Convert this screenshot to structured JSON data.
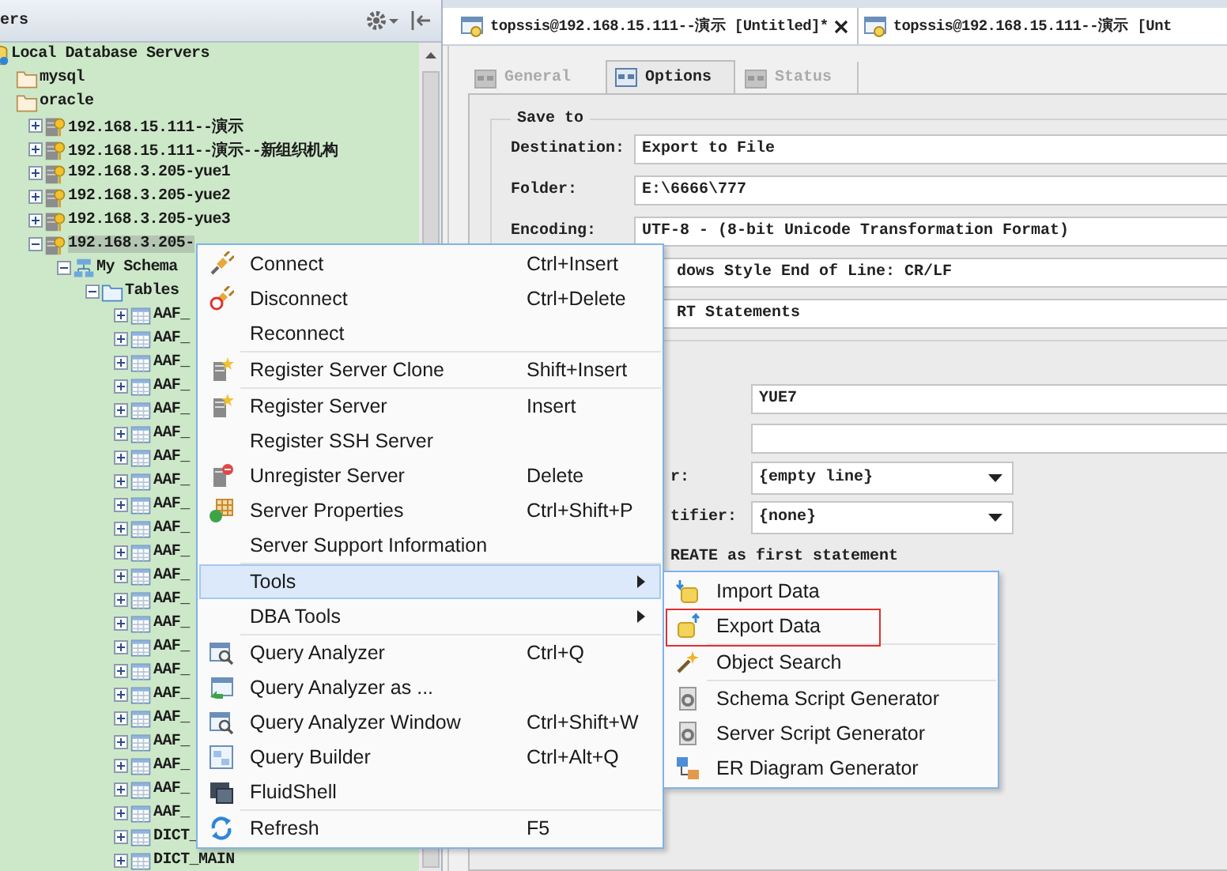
{
  "left_panel": {
    "title": "ers",
    "tree": [
      {
        "label": "Local Database Servers",
        "kind": "root",
        "selected": false,
        "children": [
          {
            "label": "mysql",
            "kind": "folder",
            "selected": false
          },
          {
            "label": "oracle",
            "kind": "folder",
            "selected": false,
            "children": [
              {
                "label": "192.168.15.111--演示",
                "kind": "server",
                "expanded": false,
                "selected": false
              },
              {
                "label": "192.168.15.111--演示--新组织机构",
                "kind": "server",
                "expanded": false,
                "selected": false
              },
              {
                "label": "192.168.3.205-yue1",
                "kind": "server",
                "expanded": false,
                "selected": false
              },
              {
                "label": "192.168.3.205-yue2",
                "kind": "server",
                "expanded": false,
                "selected": false
              },
              {
                "label": "192.168.3.205-yue3",
                "kind": "server",
                "expanded": false,
                "selected": false
              },
              {
                "label": "192.168.3.205-",
                "kind": "server",
                "expanded": true,
                "selected": true,
                "children": [
                  {
                    "label": "My Schema",
                    "kind": "schema",
                    "expanded": true,
                    "selected": false,
                    "children": [
                      {
                        "label": "Tables",
                        "kind": "tables",
                        "expanded": true,
                        "selected": false,
                        "children": [
                          {
                            "label": "AAF_",
                            "kind": "table",
                            "expanded": false,
                            "selected": false
                          },
                          {
                            "label": "AAF_",
                            "kind": "table",
                            "expanded": false,
                            "selected": false
                          },
                          {
                            "label": "AAF_",
                            "kind": "table",
                            "expanded": false,
                            "selected": false
                          },
                          {
                            "label": "AAF_",
                            "kind": "table",
                            "expanded": false,
                            "selected": false
                          },
                          {
                            "label": "AAF_",
                            "kind": "table",
                            "expanded": false,
                            "selected": false
                          },
                          {
                            "label": "AAF_",
                            "kind": "table",
                            "expanded": false,
                            "selected": false
                          },
                          {
                            "label": "AAF_",
                            "kind": "table",
                            "expanded": false,
                            "selected": false
                          },
                          {
                            "label": "AAF_",
                            "kind": "table",
                            "expanded": false,
                            "selected": false
                          },
                          {
                            "label": "AAF_",
                            "kind": "table",
                            "expanded": false,
                            "selected": false
                          },
                          {
                            "label": "AAF_",
                            "kind": "table",
                            "expanded": false,
                            "selected": false
                          },
                          {
                            "label": "AAF_",
                            "kind": "table",
                            "expanded": false,
                            "selected": false
                          },
                          {
                            "label": "AAF_",
                            "kind": "table",
                            "expanded": false,
                            "selected": false
                          },
                          {
                            "label": "AAF_",
                            "kind": "table",
                            "expanded": false,
                            "selected": false
                          },
                          {
                            "label": "AAF_",
                            "kind": "table",
                            "expanded": false,
                            "selected": false
                          },
                          {
                            "label": "AAF_",
                            "kind": "table",
                            "expanded": false,
                            "selected": false
                          },
                          {
                            "label": "AAF_",
                            "kind": "table",
                            "expanded": false,
                            "selected": false
                          },
                          {
                            "label": "AAF_",
                            "kind": "table",
                            "expanded": false,
                            "selected": false
                          },
                          {
                            "label": "AAF_",
                            "kind": "table",
                            "expanded": false,
                            "selected": false
                          },
                          {
                            "label": "AAF_",
                            "kind": "table",
                            "expanded": false,
                            "selected": false
                          },
                          {
                            "label": "AAF_",
                            "kind": "table",
                            "expanded": false,
                            "selected": false
                          },
                          {
                            "label": "AAF_",
                            "kind": "table",
                            "expanded": false,
                            "selected": false
                          },
                          {
                            "label": "AAF_",
                            "kind": "table",
                            "expanded": false,
                            "selected": false
                          },
                          {
                            "label": "DICT_",
                            "kind": "table",
                            "expanded": false,
                            "selected": false
                          },
                          {
                            "label": "DICT_MAIN",
                            "kind": "table",
                            "expanded": false,
                            "selected": false
                          }
                        ]
                      }
                    ]
                  }
                ]
              }
            ]
          }
        ]
      }
    ]
  },
  "document_tabs": [
    {
      "label": "topssis@192.168.15.111--演示 [Untitled]*",
      "closable": true
    },
    {
      "label": "topssis@192.168.15.111--演示 [Unt",
      "closable": false
    }
  ],
  "option_tabs": [
    {
      "label": "General",
      "selected": false,
      "disabled": true
    },
    {
      "label": "Options",
      "selected": true,
      "disabled": false
    },
    {
      "label": "Status",
      "selected": false,
      "disabled": true
    }
  ],
  "save_to": {
    "title": "Save to",
    "rows": [
      {
        "kind": "field",
        "label": "Destination:",
        "value": "Export to File"
      },
      {
        "kind": "field",
        "label": "Folder:",
        "value": "E:\\6666\\777"
      },
      {
        "kind": "field",
        "label": "Encoding:",
        "value": "UTF-8 - (8-bit Unicode Transformation Format)"
      },
      {
        "kind": "covered",
        "value": "dows Style End of Line: CR/LF"
      },
      {
        "kind": "covered",
        "value": "RT Statements"
      }
    ]
  },
  "options_rows": [
    {
      "kind": "field",
      "value": "YUE7"
    },
    {
      "kind": "field"
    },
    {
      "kind": "dropdown",
      "label": "r:",
      "value": "{empty line}"
    },
    {
      "kind": "dropdown",
      "label": "tifier:",
      "value": "{none}"
    },
    {
      "kind": "checkbox",
      "label": "REATE as first statement"
    }
  ],
  "context_menu": {
    "sections": [
      [
        {
          "label": "Connect",
          "shortcut": "Ctrl+Insert",
          "kind": "connect",
          "submenu": false,
          "selected": false
        },
        {
          "label": "Disconnect",
          "shortcut": "Ctrl+Delete",
          "kind": "disconnect",
          "submenu": false,
          "selected": false
        },
        {
          "label": "Reconnect",
          "kind": "none",
          "submenu": false,
          "selected": false
        }
      ],
      [
        {
          "label": "Register Server Clone",
          "shortcut": "Shift+Insert",
          "kind": "register",
          "submenu": false,
          "selected": false
        }
      ],
      [
        {
          "label": "Register Server",
          "shortcut": "Insert",
          "kind": "register",
          "submenu": false,
          "selected": false
        },
        {
          "label": "Register SSH Server",
          "kind": "none",
          "submenu": false,
          "selected": false
        },
        {
          "label": "Unregister Server",
          "shortcut": "Delete",
          "kind": "unregister",
          "submenu": false,
          "selected": false
        },
        {
          "label": "Server Properties",
          "shortcut": "Ctrl+Shift+P",
          "kind": "properties",
          "submenu": false,
          "selected": false
        },
        {
          "label": "Server Support Information",
          "kind": "none",
          "submenu": false,
          "selected": false
        }
      ],
      [
        {
          "label": "Tools",
          "kind": "none",
          "submenu": true,
          "selected": true
        },
        {
          "label": "DBA Tools",
          "kind": "none",
          "submenu": true,
          "selected": false
        }
      ],
      [
        {
          "label": "Query Analyzer",
          "shortcut": "Ctrl+Q",
          "kind": "query",
          "submenu": false,
          "selected": false
        },
        {
          "label": "Query Analyzer as ...",
          "kind": "query-as",
          "submenu": false,
          "selected": false
        },
        {
          "label": "Query Analyzer Window",
          "shortcut": "Ctrl+Shift+W",
          "kind": "query",
          "submenu": false,
          "selected": false
        },
        {
          "label": "Query Builder",
          "shortcut": "Ctrl+Alt+Q",
          "kind": "builder",
          "submenu": false,
          "selected": false
        },
        {
          "label": "FluidShell",
          "kind": "shell",
          "submenu": false,
          "selected": false
        }
      ],
      [
        {
          "label": "Refresh",
          "shortcut": "F5",
          "kind": "refresh",
          "submenu": false,
          "selected": false
        }
      ]
    ]
  },
  "tools_submenu": {
    "sections": [
      [
        {
          "label": "Import Data",
          "kind": "import",
          "outlined": false
        },
        {
          "label": "Export Data",
          "kind": "export",
          "outlined": true
        }
      ],
      [
        {
          "label": "Object Search",
          "kind": "search",
          "outlined": false
        }
      ],
      [
        {
          "label": "Schema Script Generator",
          "kind": "script",
          "outlined": false
        },
        {
          "label": "Server Script Generator",
          "kind": "script",
          "outlined": false
        },
        {
          "label": "ER Diagram Generator",
          "kind": "er",
          "outlined": false
        }
      ]
    ]
  }
}
